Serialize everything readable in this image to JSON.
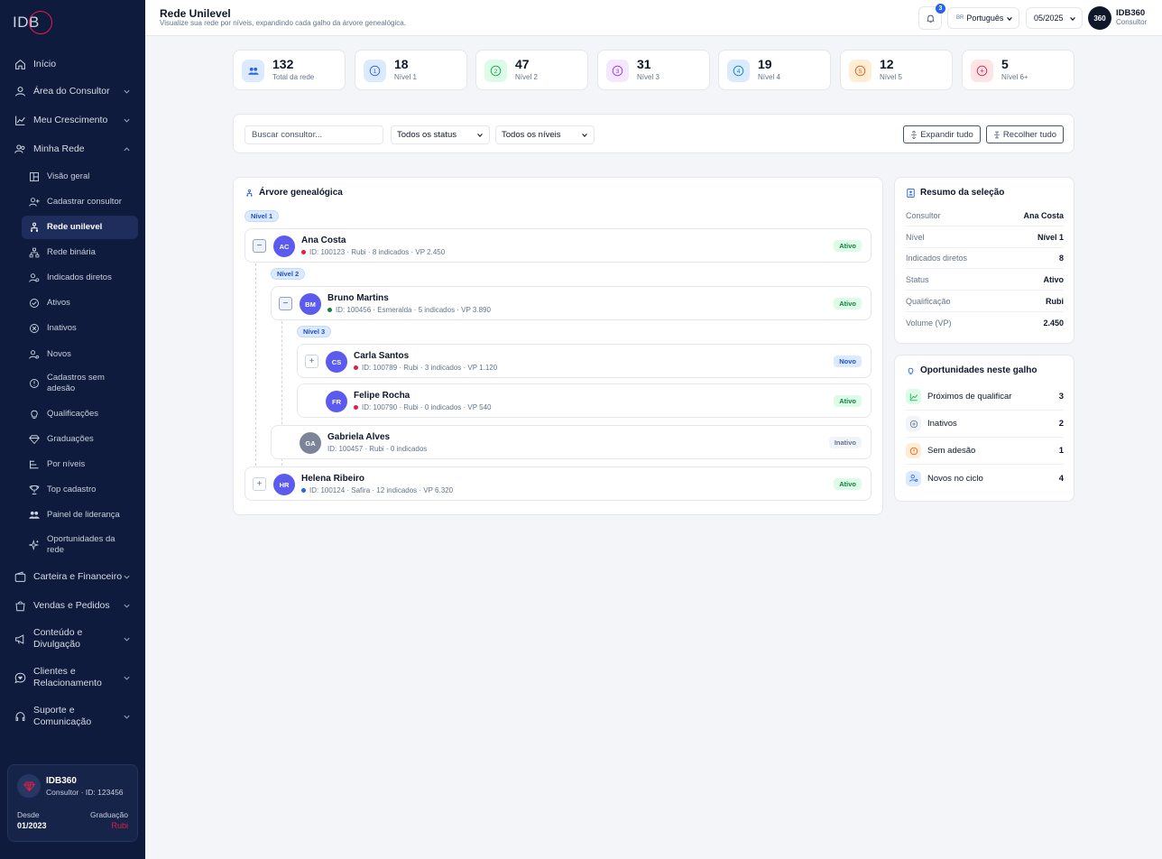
{
  "app": {
    "logo_text": "IDB",
    "logo_ring": "360"
  },
  "header": {
    "title": "Rede Unilevel",
    "subtitle": "Visualize sua rede por níveis, expandindo cada galho da árvore genealógica.",
    "notifications": "3",
    "language_flag": "BR",
    "language": "Português",
    "period": "05/2025",
    "avatar": "360",
    "user_name": "IDB360",
    "user_role": "Consultor"
  },
  "sidebar": {
    "items": [
      {
        "label": "Início",
        "icon": "home-icon"
      },
      {
        "label": "Área do Consultor",
        "icon": "user-icon"
      },
      {
        "label": "Meu Crescimento",
        "icon": "chart-line-icon"
      },
      {
        "label": "Minha Rede",
        "icon": "users-icon"
      }
    ],
    "sub_items": [
      {
        "label": "Visão geral"
      },
      {
        "label": "Cadastrar consultor"
      },
      {
        "label": "Rede unilevel"
      },
      {
        "label": "Rede binária"
      },
      {
        "label": "Indicados diretos"
      },
      {
        "label": "Ativos"
      },
      {
        "label": "Inativos"
      },
      {
        "label": "Novos"
      },
      {
        "label": "Cadastros sem adesão"
      },
      {
        "label": "Qualificações"
      },
      {
        "label": "Graduações"
      },
      {
        "label": "Por níveis"
      },
      {
        "label": "Top cadastro"
      },
      {
        "label": "Painel de liderança"
      },
      {
        "label": "Oportunidades da rede"
      }
    ],
    "bottom_items": [
      {
        "label": "Carteira e Financeiro"
      },
      {
        "label": "Vendas e Pedidos"
      },
      {
        "label": "Conteúdo e Divulgação"
      },
      {
        "label": "Clientes e Relacionamento"
      },
      {
        "label": "Suporte e Comunicação"
      }
    ],
    "profile": {
      "name": "IDB360",
      "subtitle": "Consultor · ID: 123456",
      "since_label": "Desde",
      "since_value": "01/2023",
      "grad_label": "Graduação",
      "grad_value": "Rubi"
    }
  },
  "stats": [
    {
      "value": "132",
      "label": "Total da rede",
      "icon": "users-icon"
    },
    {
      "value": "18",
      "label": "Nível 1",
      "icon": "level-1-icon",
      "glyph": "1"
    },
    {
      "value": "47",
      "label": "Nível 2",
      "icon": "level-2-icon",
      "glyph": "2"
    },
    {
      "value": "31",
      "label": "Nível 3",
      "icon": "level-3-icon",
      "glyph": "3"
    },
    {
      "value": "19",
      "label": "Nível 4",
      "icon": "level-4-icon",
      "glyph": "4"
    },
    {
      "value": "12",
      "label": "Nível 5",
      "icon": "level-5-icon",
      "glyph": "5"
    },
    {
      "value": "5",
      "label": "Nível 6+",
      "icon": "level-6-icon",
      "glyph": "+"
    }
  ],
  "filters": {
    "search_placeholder": "Buscar consultor...",
    "status": "Todos os status",
    "levels": "Todos os níveis",
    "expand": "Expandir tudo",
    "collapse": "Recolher tudo"
  },
  "tree": {
    "title": "Árvore genealógica",
    "level1": "Nível 1",
    "level2": "Nível 2",
    "level3": "Nível 3",
    "nodes": {
      "ana": {
        "initials": "AC",
        "name": "Ana Costa",
        "meta": "ID: 100123 · Rubi · 8 indicados · VP 2.450",
        "status": "Ativo",
        "toggle": "−"
      },
      "bruno": {
        "initials": "BM",
        "name": "Bruno Martins",
        "meta": "ID: 100456 · Esmeralda · 5 indicados · VP 3.890",
        "status": "Ativo",
        "toggle": "−"
      },
      "carla": {
        "initials": "CS",
        "name": "Carla Santos",
        "meta": "ID: 100789 · Rubi · 3 indicados · VP 1.120",
        "status": "Novo",
        "toggle": "+"
      },
      "felipe": {
        "initials": "FR",
        "name": "Felipe Rocha",
        "meta": "ID: 100790 · Rubi · 0 indicados · VP 540",
        "status": "Ativo"
      },
      "gabriela": {
        "initials": "GA",
        "name": "Gabriela Alves",
        "meta": "ID: 100457 · Rubi · 0 indicados",
        "status": "Inativo"
      },
      "helena": {
        "initials": "HR",
        "name": "Helena Ribeiro",
        "meta": "ID: 100124 · Safira · 12 indicados · VP 6.320",
        "status": "Ativo",
        "toggle": "+"
      }
    }
  },
  "summary": {
    "title": "Resumo da seleção",
    "rows": [
      {
        "k": "Consultor",
        "v": "Ana Costa"
      },
      {
        "k": "Nível",
        "v": "Nível 1"
      },
      {
        "k": "Indicados diretos",
        "v": "8"
      },
      {
        "k": "Status",
        "v": "Ativo"
      },
      {
        "k": "Qualificação",
        "v": "Rubi"
      },
      {
        "k": "Volume (VP)",
        "v": "2.450"
      }
    ]
  },
  "opportunities": {
    "title": "Oportunidades neste galho",
    "rows": [
      {
        "label": "Próximos de qualificar",
        "value": "3"
      },
      {
        "label": "Inativos",
        "value": "2"
      },
      {
        "label": "Sem adesão",
        "value": "1"
      },
      {
        "label": "Novos no ciclo",
        "value": "4"
      }
    ]
  },
  "colors": {
    "sidebar": "#0f1b3d",
    "accent": "#2563eb",
    "brand": "#e11d48",
    "avatar": "#5b5bf0"
  }
}
